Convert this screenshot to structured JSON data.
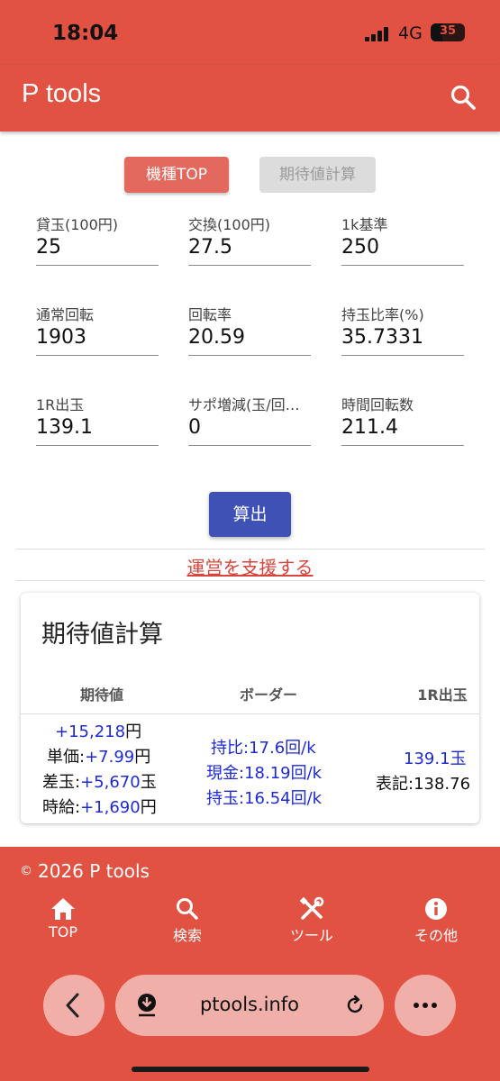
{
  "status": {
    "time": "18:04",
    "network": "4G",
    "battery": "35",
    "battery_fraction": 0.35
  },
  "appbar": {
    "title": "P tools",
    "icon": "search-icon"
  },
  "buttons": {
    "top": "機種TOP",
    "calc": "期待値計算"
  },
  "fields": [
    {
      "label": "貸玉(100円)",
      "value": "25"
    },
    {
      "label": "交換(100円)",
      "value": "27.5"
    },
    {
      "label": "1k基準",
      "value": "250"
    },
    {
      "label": "通常回転",
      "value": "1903"
    },
    {
      "label": "回転率",
      "value": "20.59"
    },
    {
      "label": "持玉比率(%)",
      "value": "35.7331"
    },
    {
      "label": "1R出玉",
      "value": "139.1"
    },
    {
      "label": "サポ増減(玉/回…",
      "value": "0"
    },
    {
      "label": "時間回転数",
      "value": "211.4"
    }
  ],
  "compute_label": "算出",
  "support_link": "運営を支援する",
  "result_card": {
    "title": "期待値計算",
    "headers": [
      "期待値",
      "ボーダー",
      "1R出玉"
    ],
    "expected": {
      "total": "+15,218",
      "total_unit": "円",
      "unit_label": "単価:",
      "unit_value": "+7.99",
      "unit_unit": "円",
      "diff_label": "差玉:",
      "diff_value": "+5,670",
      "diff_unit": "玉",
      "hourly_label": "時給:",
      "hourly_value": "+1,690",
      "hourly_unit": "円"
    },
    "border": [
      "持比:17.6回/k",
      "現金:18.19回/k",
      "持玉:16.54回/k"
    ],
    "payout": {
      "value": "139.1玉",
      "note": "表記:138.76"
    }
  },
  "footer": {
    "copyright_symbol": "©",
    "copyright": "2026 P tools"
  },
  "bottom_nav": [
    {
      "label": "TOP",
      "icon": "home-icon"
    },
    {
      "label": "検索",
      "icon": "search-icon"
    },
    {
      "label": "ツール",
      "icon": "tools-icon"
    },
    {
      "label": "その他",
      "icon": "info-icon"
    }
  ],
  "browser": {
    "url": "ptools.info"
  },
  "colors": {
    "brand": "#e15243",
    "accent_button": "#3f51b5",
    "value_blue": "#1d2ad6",
    "link": "#d9443a"
  }
}
